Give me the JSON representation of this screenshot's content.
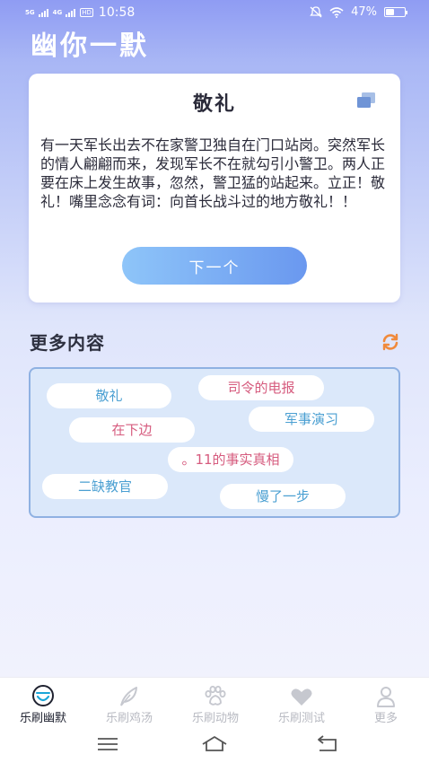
{
  "status_bar": {
    "signal1": "5G",
    "signal2": "4G",
    "hd": "HD",
    "time": "10:58",
    "battery_text": "47%",
    "battery_level": 0.47
  },
  "app": {
    "title": "幽你一默"
  },
  "joke": {
    "title": "敬礼",
    "text": "有一天军长出去不在家警卫独自在门口站岗。突然军长的情人翩翩而来，发现军长不在就勾引小警卫。两人正要在床上发生故事，忽然，警卫猛的站起来。立正！敬礼！嘴里念念有词：向首长战斗过的地方敬礼！！",
    "next_label": "下一个"
  },
  "more": {
    "title": "更多内容",
    "tags": [
      {
        "label": "敬礼"
      },
      {
        "label": "司令的电报"
      },
      {
        "label": "军事演习"
      },
      {
        "label": "在下边"
      },
      {
        "label": "。11的事实真相"
      },
      {
        "label": "二缺教官"
      },
      {
        "label": "慢了一步"
      }
    ]
  },
  "nav": {
    "items": [
      {
        "label": "乐刷幽默",
        "icon": "smile-icon"
      },
      {
        "label": "乐刷鸡汤",
        "icon": "feather-icon"
      },
      {
        "label": "乐刷动物",
        "icon": "paw-icon"
      },
      {
        "label": "乐刷测试",
        "icon": "heart-icon"
      },
      {
        "label": "更多",
        "icon": "person-icon"
      }
    ]
  },
  "colors": {
    "accent": "#6a98ef",
    "tag_blue": "#4a9fd2",
    "tag_pink": "#d65b7e",
    "refresh": "#f08a3c"
  }
}
